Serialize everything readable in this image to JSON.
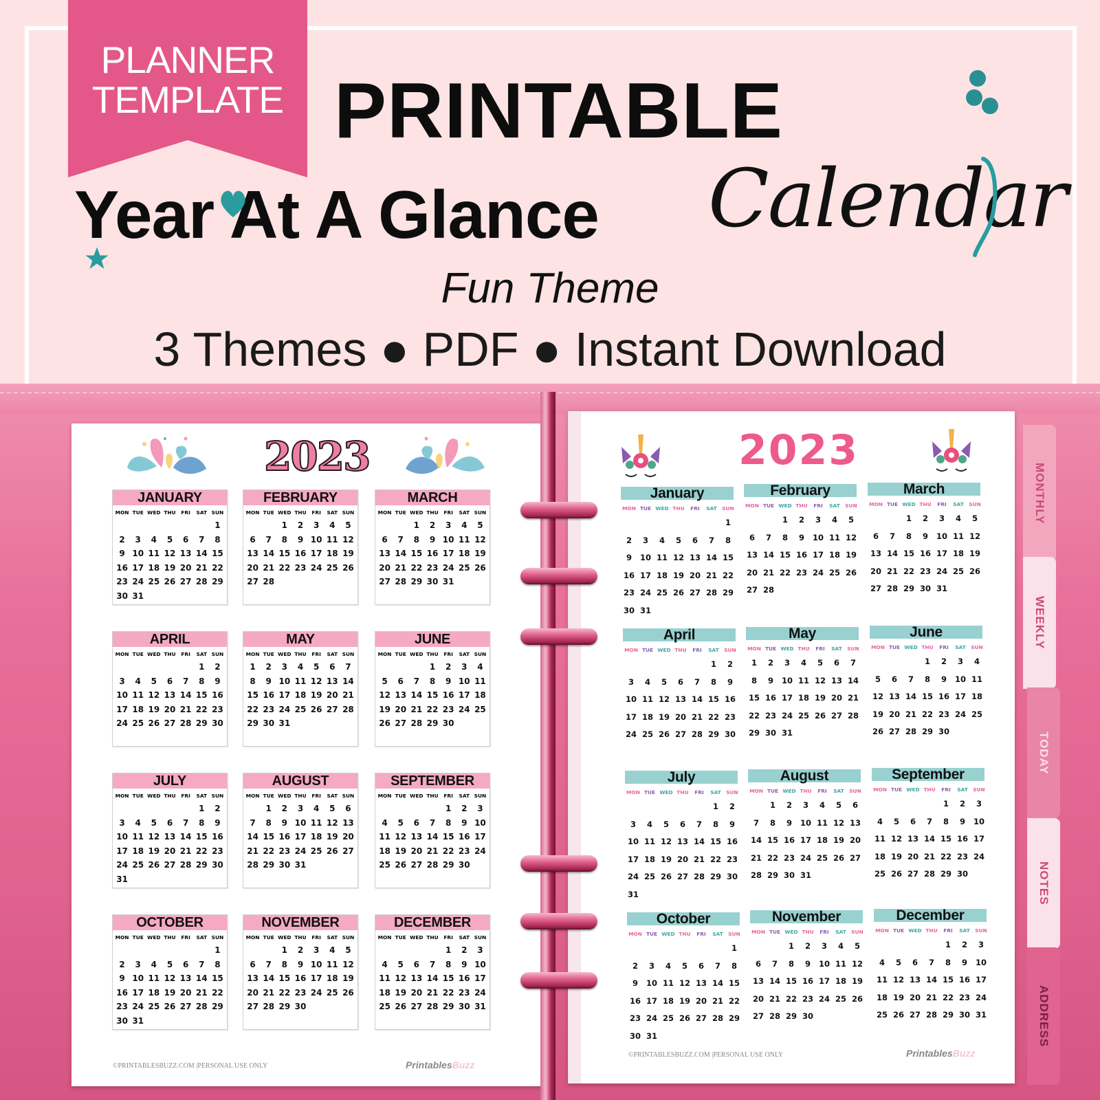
{
  "banner": {
    "ribbon_line1": "PLANNER",
    "ribbon_line2": "TEMPLATE",
    "title_line1": "PRINTABLE",
    "title_line2": "Year At A Glance",
    "title_script": "Calendar",
    "subtitle": "Fun Theme",
    "features": "3 Themes ● PDF ● Instant Download",
    "icons": [
      "heart-icon",
      "star-icon",
      "flower-dots-icon",
      "swirl-icon"
    ],
    "colors": {
      "ribbon": "#e35888",
      "accent_teal": "#2a9ca0",
      "background": "#fde3e3"
    }
  },
  "weekday_labels": [
    "MON",
    "TUE",
    "WED",
    "THU",
    "FRI",
    "SAT",
    "SUN"
  ],
  "left_page": {
    "year": "2023",
    "header_color": "#f5a9c2",
    "months": [
      {
        "name": "JANUARY",
        "offset": 6,
        "days": 31
      },
      {
        "name": "FEBRUARY",
        "offset": 2,
        "days": 28
      },
      {
        "name": "MARCH",
        "offset": 2,
        "days": 31
      },
      {
        "name": "APRIL",
        "offset": 5,
        "days": 30
      },
      {
        "name": "MAY",
        "offset": 0,
        "days": 31
      },
      {
        "name": "JUNE",
        "offset": 3,
        "days": 30
      },
      {
        "name": "JULY",
        "offset": 5,
        "days": 31
      },
      {
        "name": "AUGUST",
        "offset": 1,
        "days": 31
      },
      {
        "name": "SEPTEMBER",
        "offset": 4,
        "days": 30
      },
      {
        "name": "OCTOBER",
        "offset": 6,
        "days": 31
      },
      {
        "name": "NOVEMBER",
        "offset": 2,
        "days": 30
      },
      {
        "name": "DECEMBER",
        "offset": 4,
        "days": 31
      }
    ],
    "footer_copy": "©PRINTABLESBUZZ.COM |PERSONAL USE ONLY",
    "footer_logo_a": "Printables",
    "footer_logo_b": "Buzz"
  },
  "right_page": {
    "year": "2023",
    "header_color": "#99d1d1",
    "weekday_colors": [
      "#e7649a",
      "#8a5bb0",
      "#3fa6a2",
      "#e7649a",
      "#8a5bb0",
      "#3fa6a2",
      "#e7649a"
    ],
    "months": [
      {
        "name": "January",
        "offset": 6,
        "days": 31
      },
      {
        "name": "February",
        "offset": 2,
        "days": 28
      },
      {
        "name": "March",
        "offset": 2,
        "days": 31
      },
      {
        "name": "April",
        "offset": 5,
        "days": 30
      },
      {
        "name": "May",
        "offset": 0,
        "days": 31
      },
      {
        "name": "June",
        "offset": 3,
        "days": 30
      },
      {
        "name": "July",
        "offset": 5,
        "days": 31
      },
      {
        "name": "August",
        "offset": 1,
        "days": 31
      },
      {
        "name": "September",
        "offset": 4,
        "days": 30
      },
      {
        "name": "October",
        "offset": 6,
        "days": 31
      },
      {
        "name": "November",
        "offset": 2,
        "days": 30
      },
      {
        "name": "December",
        "offset": 4,
        "days": 31
      }
    ],
    "footer_copy": "©PRINTABLESBUZZ.COM |PERSONAL USE ONLY",
    "footer_logo_a": "Printables",
    "footer_logo_b": "Buzz"
  },
  "tabs": [
    {
      "label": "MONTHLY",
      "bg": "#f2a7bf",
      "fg": "#c94a78"
    },
    {
      "label": "WEEKLY",
      "bg": "#fbe1e9",
      "fg": "#c94a78"
    },
    {
      "label": "TODAY",
      "bg": "#e985a7",
      "fg": "#f9e0e8"
    },
    {
      "label": "NOTES",
      "bg": "#fbe1e9",
      "fg": "#c94a78"
    },
    {
      "label": "ADDRESS",
      "bg": "#e0648f",
      "fg": "#7a1f42"
    }
  ]
}
